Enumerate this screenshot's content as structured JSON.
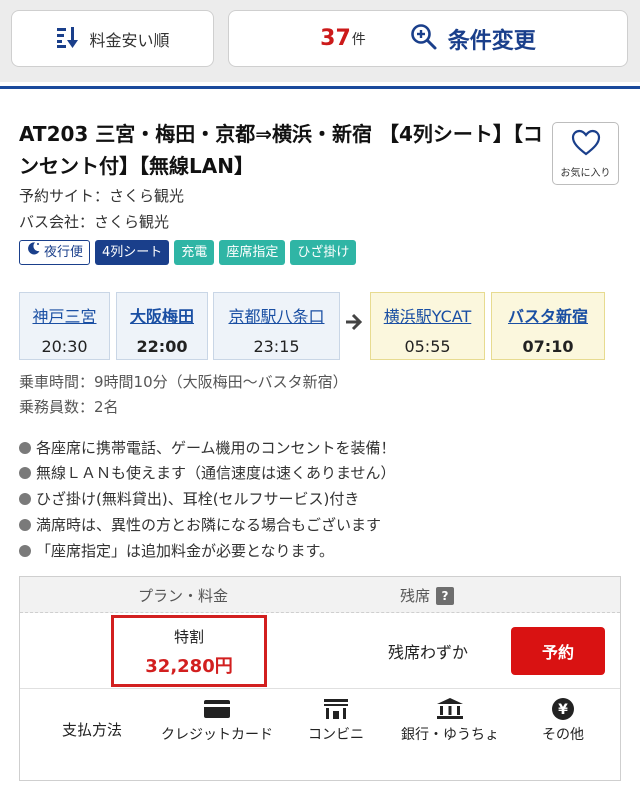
{
  "header": {
    "sort_label": "料金安い順",
    "count": "37",
    "count_unit": "件",
    "change_conditions_label": "条件変更"
  },
  "bus": {
    "title": "AT203 三宮・梅田・京都⇒横浜・新宿 【4列シート】【コンセント付】【無線LAN】",
    "favorite_label": "お気に入り",
    "booking_site": "予約サイト：さくら観光",
    "bus_company": "バス会社：さくら観光",
    "tags": [
      "夜行便",
      "4列シート",
      "充電",
      "座席指定",
      "ひざ掛け"
    ],
    "stops": [
      {
        "name": "神戸三宮",
        "time": "20:30"
      },
      {
        "name": "大阪梅田",
        "time": "22:00"
      },
      {
        "name": "京都駅八条口",
        "time": "23:15"
      },
      {
        "name": "横浜駅YCAT",
        "time": "05:55"
      },
      {
        "name": "バスタ新宿",
        "time": "07:10"
      }
    ],
    "ride_time": "乗車時間：9時間10分（大阪梅田〜バスタ新宿）",
    "crew": "乗務員数：2名",
    "features": [
      "各座席に携帯電話、ゲーム機用のコンセントを装備！",
      "無線ＬＡＮも使えます（通信速度は速くありません）",
      "ひざ掛け(無料貸出)、耳栓(セルフサービス)付き",
      "満席時は、異性の方とお隣になる場合もございます",
      "「座席指定」は追加料金が必要となります。"
    ]
  },
  "plan": {
    "header_plan": "プラン・料金",
    "header_seats": "残席",
    "help_mark": "?",
    "plan_name": "特割",
    "price": "32,280円",
    "seat_status": "残席わずか",
    "reserve_label": "予約",
    "payment_label": "支払方法",
    "payment_methods": [
      "クレジットカード",
      "コンビニ",
      "銀行・ゆうちょ",
      "その他"
    ]
  },
  "colors": {
    "brand_blue": "#1a3f8b",
    "accent_red": "#d21f1f",
    "teal_tag": "#2fb5a5"
  }
}
